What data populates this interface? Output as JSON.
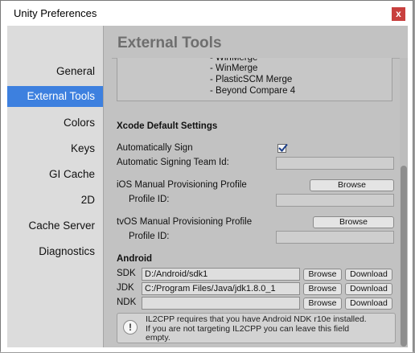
{
  "window": {
    "title": "Unity Preferences",
    "close_glyph": "x"
  },
  "sidebar": {
    "items": [
      {
        "label": "General"
      },
      {
        "label": "External Tools",
        "selected": true
      },
      {
        "label": "Colors"
      },
      {
        "label": "Keys"
      },
      {
        "label": "GI Cache"
      },
      {
        "label": "2D"
      },
      {
        "label": "Cache Server"
      },
      {
        "label": "Diagnostics"
      }
    ]
  },
  "main": {
    "title": "External Tools",
    "diff_tools": [
      "- WinMerge",
      "- WinMerge",
      "- PlasticSCM Merge",
      "- Beyond Compare 4"
    ],
    "xcode": {
      "header": "Xcode Default Settings",
      "auto_sign_label": "Automatically Sign",
      "auto_sign_checked": true,
      "team_id_label": "Automatic Signing Team Id:",
      "team_id_value": "",
      "ios_profile_label": "iOS Manual Provisioning Profile",
      "ios_browse": "Browse",
      "ios_profile_id_label": "Profile ID:",
      "ios_profile_id_value": "",
      "tvos_profile_label": "tvOS Manual Provisioning Profile",
      "tvos_browse": "Browse",
      "tvos_profile_id_label": "Profile ID:",
      "tvos_profile_id_value": ""
    },
    "android": {
      "header": "Android",
      "sdk_label": "SDK",
      "sdk_value": "D:/Android/sdk1",
      "jdk_label": "JDK",
      "jdk_value": "C:/Program Files/Java/jdk1.8.0_1",
      "ndk_label": "NDK",
      "ndk_value": "",
      "browse": "Browse",
      "download": "Download"
    },
    "help": {
      "icon_glyph": "!",
      "line1": "IL2CPP requires that you have Android NDK r10e installed.",
      "line2": "If you are not targeting IL2CPP you can leave this field",
      "line3": "empty."
    }
  },
  "colors": {
    "selection": "#3d80df",
    "close_button": "#c8403e"
  }
}
